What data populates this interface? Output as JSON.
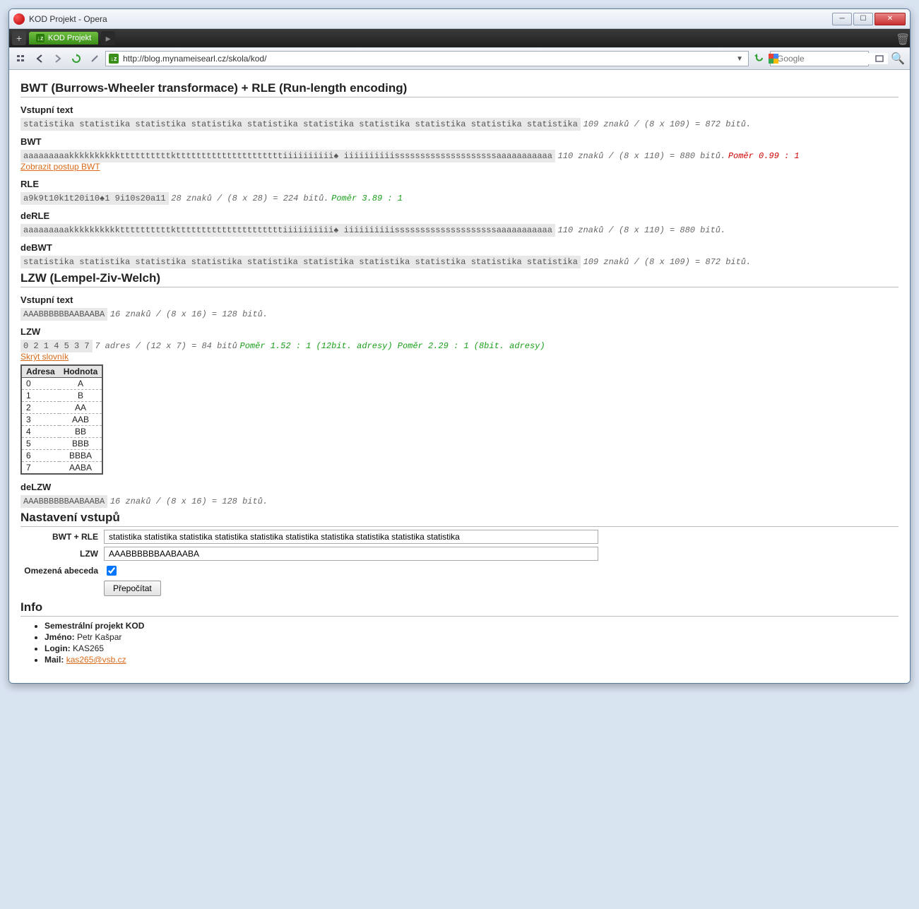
{
  "window": {
    "title": "KOD Projekt - Opera"
  },
  "tab": {
    "label": "KOD Projekt",
    "fav": "↓z"
  },
  "addressbar": {
    "url": "http://blog.mynameisearl.cz/skola/kod/",
    "fav": "↓z"
  },
  "searchbox": {
    "placeholder": "Google"
  },
  "bwt": {
    "heading": "BWT (Burrows-Wheeler transformace) + RLE (Run-length encoding)",
    "input": {
      "label": "Vstupní text",
      "data": "statistika statistika statistika statistika statistika statistika statistika statistika statistika statistika",
      "stats": "109 znaků / (8 x 109) = 872 bitů."
    },
    "bwt_out": {
      "label": "BWT",
      "data": "aaaaaaaaakkkkkkkkkkttttttttttktttttttttttttttttttttiiiiiiiiii♠ iiiiiiiiiissssssssssssssssssssaaaaaaaaaaa",
      "stats": "110 znaků / (8 x 110) = 880 bitů.",
      "ratio": "Poměr 0.99 : 1",
      "link": "Zobrazit postup BWT"
    },
    "rle": {
      "label": "RLE",
      "data": "a9k9t10k1t20i10♠1 9i10s20a11",
      "stats": "28 znaků / (8 x 28) = 224 bitů.",
      "ratio": "Poměr 3.89 : 1"
    },
    "derle": {
      "label": "deRLE",
      "data": "aaaaaaaaakkkkkkkkkkttttttttttktttttttttttttttttttttiiiiiiiiii♠ iiiiiiiiiissssssssssssssssssssaaaaaaaaaaa",
      "stats": "110 znaků / (8 x 110) = 880 bitů."
    },
    "debwt": {
      "label": "deBWT",
      "data": "statistika statistika statistika statistika statistika statistika statistika statistika statistika statistika",
      "stats": "109 znaků / (8 x 109) = 872 bitů."
    }
  },
  "lzw": {
    "heading": "LZW (Lempel-Ziv-Welch)",
    "input": {
      "label": "Vstupní text",
      "data": "AAABBBBBBAABAABA",
      "stats": "16 znaků / (8 x 16) = 128 bitů."
    },
    "out": {
      "label": "LZW",
      "data": "0 2 1 4 5 3 7",
      "stats": "7 adres / (12 x 7) = 84 bitů",
      "ratio": "Poměr 1.52 : 1 (12bit. adresy) Poměr 2.29 : 1 (8bit. adresy)",
      "link": "Skrýt slovník"
    },
    "dict": {
      "headers": [
        "Adresa",
        "Hodnota"
      ],
      "rows": [
        [
          "0",
          "A"
        ],
        [
          "1",
          "B"
        ],
        [
          "2",
          "AA"
        ],
        [
          "3",
          "AAB"
        ],
        [
          "4",
          "BB"
        ],
        [
          "5",
          "BBB"
        ],
        [
          "6",
          "BBBA"
        ],
        [
          "7",
          "AABA"
        ]
      ]
    },
    "delzw": {
      "label": "deLZW",
      "data": "AAABBBBBBAABAABA",
      "stats": "16 znaků / (8 x 16) = 128 bitů."
    }
  },
  "settings": {
    "heading": "Nastavení vstupů",
    "bwt_label": "BWT + RLE",
    "bwt_value": "statistika statistika statistika statistika statistika statistika statistika statistika statistika statistika",
    "lzw_label": "LZW",
    "lzw_value": "AAABBBBBBAABAABA",
    "alphabet_label": "Omezená abeceda",
    "submit": "Přepočítat"
  },
  "info": {
    "heading": "Info",
    "project_bold": "Semestrální projekt KOD",
    "name_label": "Jméno:",
    "name_value": "Petr Kašpar",
    "login_label": "Login:",
    "login_value": "KAS265",
    "mail_label": "Mail:",
    "mail_value": "kas265@vsb.cz"
  }
}
